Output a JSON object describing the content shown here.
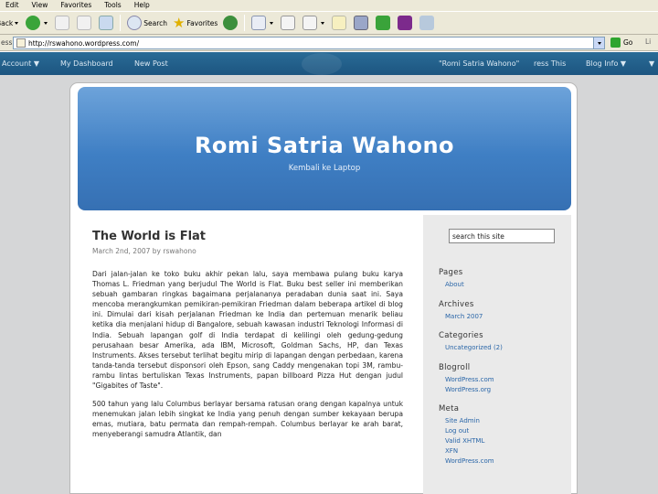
{
  "menu": [
    "Edit",
    "View",
    "Favorites",
    "Tools",
    "Help"
  ],
  "toolbar": {
    "back": "Back",
    "search": "Search",
    "favorites": "Favorites"
  },
  "address": {
    "label": "ess",
    "url": "http://rswahono.wordpress.com/",
    "go": "Go",
    "links": "Li"
  },
  "adminbar": {
    "account": "Account ▼",
    "dashboard": "My Dashboard",
    "newpost": "New Post",
    "blogname": "\"Romi Satria Wahono\"",
    "press": "ress This",
    "bloginfo": "Blog Info ▼",
    "more": "▼"
  },
  "blog": {
    "title": "Romi Satria Wahono",
    "description": "Kembali ke Laptop"
  },
  "post": {
    "title": "The World is Flat",
    "meta": "March 2nd, 2007 by rswahono",
    "paragraphs": [
      "Dari jalan-jalan ke toko buku akhir pekan lalu, saya membawa pulang buku karya Thomas L. Friedman yang berjudul The World is Flat. Buku best seller ini memberikan sebuah gambaran ringkas bagaimana perjalananya peradaban dunia saat ini. Saya mencoba merangkumkan pemikiran-pemikiran Friedman dalam beberapa artikel di blog ini. Dimulai dari kisah perjalanan Friedman ke India dan pertemuan menarik beliau ketika dia menjalani hidup di Bangalore, sebuah kawasan industri Teknologi Informasi di India. Sebuah lapangan golf di India terdapat di kelilingi oleh gedung-gedung perusahaan besar Amerika, ada IBM, Microsoft, Goldman Sachs, HP, dan Texas Instruments. Akses tersebut terlihat begitu mirip di lapangan dengan perbedaan, karena tanda-tanda tersebut disponsori oleh Epson, sang Caddy mengenakan topi 3M, rambu-rambu lintas bertuliskan Texas Instruments, papan billboard Pizza Hut dengan judul \"Gigabites of Taste\".",
      "500 tahun yang lalu Columbus berlayar bersama ratusan orang dengan kapalnya untuk menemukan jalan lebih singkat ke India yang penuh dengan sumber kekayaan berupa emas, mutiara, batu permata dan rempah-rempah. Columbus berlayar ke arah barat, menyeberangi samudra Atlantik, dan"
    ]
  },
  "sidebar": {
    "search_value": "search this site",
    "pages": {
      "title": "Pages",
      "items": [
        "About"
      ]
    },
    "archives": {
      "title": "Archives",
      "items": [
        "March 2007"
      ]
    },
    "categories": {
      "title": "Categories",
      "items": [
        "Uncategorized (2)"
      ]
    },
    "blogroll": {
      "title": "Blogroll",
      "items": [
        "WordPress.com",
        "WordPress.org"
      ]
    },
    "meta": {
      "title": "Meta",
      "items": [
        "Site Admin",
        "Log out",
        "Valid XHTML",
        "XFN",
        "WordPress.com"
      ]
    }
  },
  "colors": {
    "admin_bar": "#1f5d8a",
    "header": "#4a88cb",
    "page_bg": "#d5d6d7",
    "link": "#2a66a8"
  }
}
